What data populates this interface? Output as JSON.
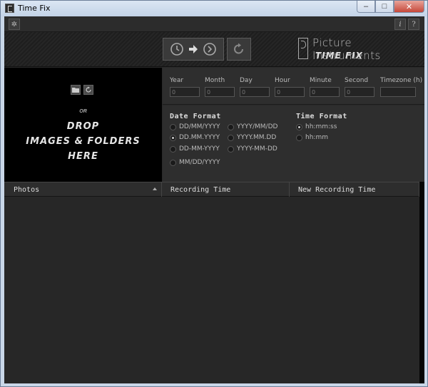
{
  "window": {
    "title": "Time Fix",
    "controls": {
      "minimize": "–",
      "maximize": "□",
      "close": "✕"
    }
  },
  "toolbar": {
    "settings_icon": "gear-icon",
    "info_label": "i",
    "help_label": "?"
  },
  "header": {
    "apply_button_icons": [
      "clock-icon",
      "arrow-right-icon",
      "circle-arrow-icon"
    ],
    "reset_button_icon": "reset-icon",
    "brand_name": "Picture Instruments",
    "product_name": "TIME FIX"
  },
  "drop_zone": {
    "folder_icon": "folder-icon",
    "refresh_icon": "refresh-icon",
    "or_text": "OR",
    "line1": "DROP",
    "line2": "IMAGES & FOLDERS",
    "line3": "HERE"
  },
  "time_fields": [
    {
      "label": "Year",
      "value": "0"
    },
    {
      "label": "Month",
      "value": "0"
    },
    {
      "label": "Day",
      "value": "0"
    },
    {
      "label": "Hour",
      "value": "0"
    },
    {
      "label": "Minute",
      "value": "0"
    },
    {
      "label": "Second",
      "value": "0"
    },
    {
      "label": "Timezone (h)",
      "value": ""
    }
  ],
  "date_format": {
    "heading": "Date Format",
    "options": [
      "DD/MM/YYYY",
      "DD.MM.YYYY",
      "DD-MM-YYYY",
      "MM/DD/YYYY",
      "YYYY/MM/DD",
      "YYYY.MM.DD",
      "YYYY-MM-DD"
    ],
    "selected": "DD.MM.YYYY"
  },
  "time_format": {
    "heading": "Time Format",
    "options": [
      "hh:mm:ss",
      "hh:mm"
    ],
    "selected": "hh:mm:ss"
  },
  "table": {
    "columns": [
      "Photos",
      "Recording Time",
      "New Recording Time"
    ],
    "rows": []
  }
}
